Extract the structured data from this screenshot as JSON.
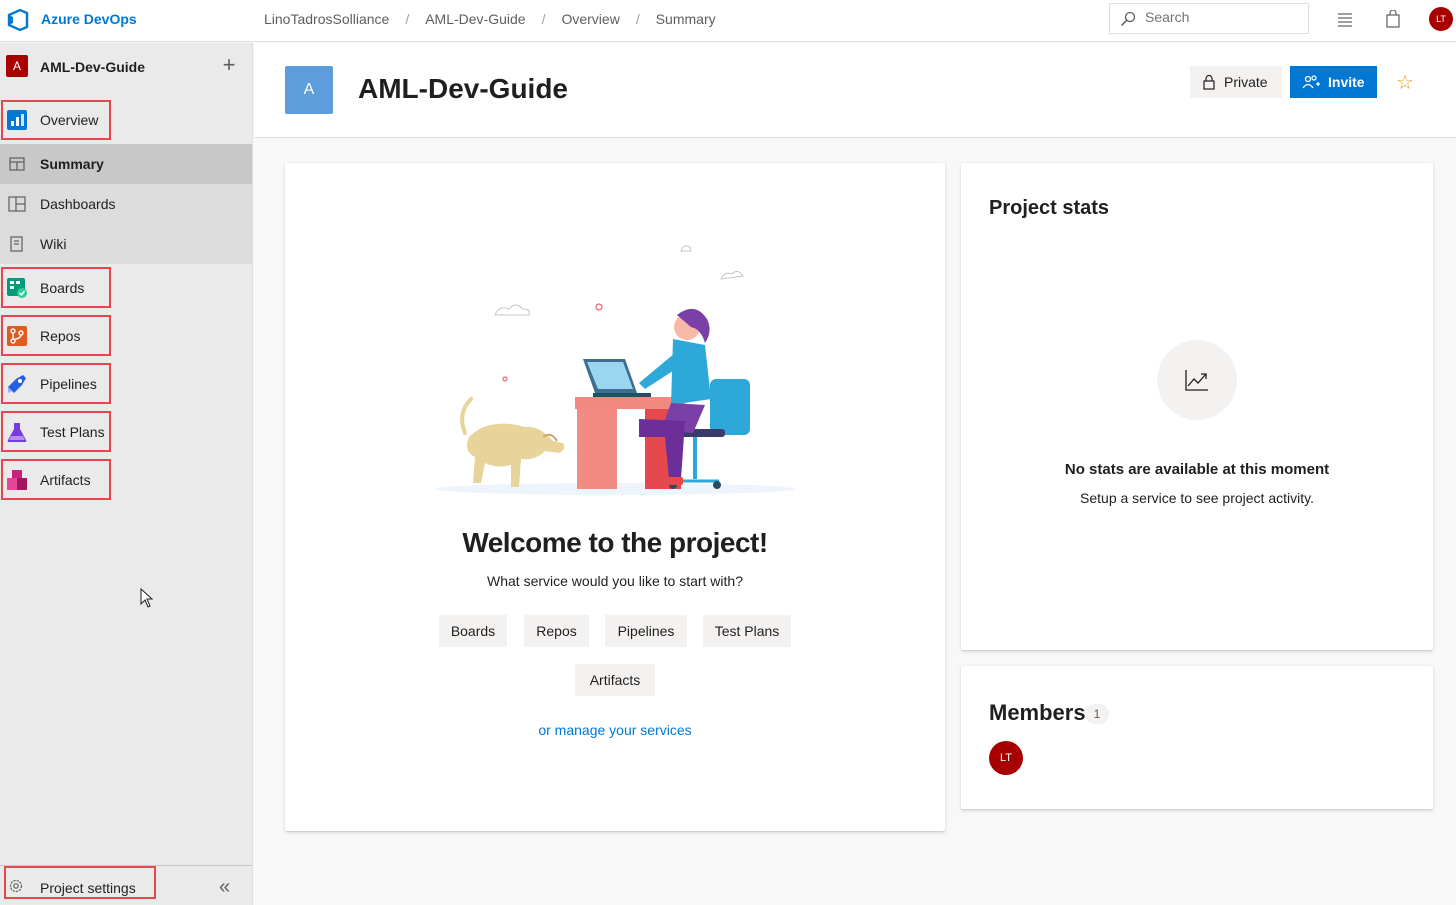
{
  "topbar": {
    "brand": "Azure DevOps",
    "breadcrumbs": [
      "LinoTadrosSolliance",
      "AML-Dev-Guide",
      "Overview",
      "Summary"
    ],
    "search_placeholder": "Search",
    "user_initials": "LT"
  },
  "sidebar": {
    "project_initial": "A",
    "project_name": "AML-Dev-Guide",
    "items": [
      {
        "label": "Overview",
        "icon": "overview-icon"
      },
      {
        "label": "Summary",
        "icon": "summary-icon"
      },
      {
        "label": "Dashboards",
        "icon": "dashboards-icon"
      },
      {
        "label": "Wiki",
        "icon": "wiki-icon"
      },
      {
        "label": "Boards",
        "icon": "boards-icon"
      },
      {
        "label": "Repos",
        "icon": "repos-icon"
      },
      {
        "label": "Pipelines",
        "icon": "pipelines-icon"
      },
      {
        "label": "Test Plans",
        "icon": "test-plans-icon"
      },
      {
        "label": "Artifacts",
        "icon": "artifacts-icon"
      }
    ],
    "settings_label": "Project settings"
  },
  "header": {
    "project_initial": "A",
    "title": "AML-Dev-Guide",
    "private_label": "Private",
    "invite_label": "Invite"
  },
  "welcome": {
    "title": "Welcome to the project!",
    "subtitle": "What service would you like to start with?",
    "services": [
      "Boards",
      "Repos",
      "Pipelines",
      "Test Plans",
      "Artifacts"
    ],
    "manage_link": "or manage your services"
  },
  "stats": {
    "title": "Project stats",
    "empty_title": "No stats are available at this moment",
    "empty_sub": "Setup a service to see project activity."
  },
  "members": {
    "title": "Members",
    "count": "1",
    "avatar_initials": "LT"
  }
}
